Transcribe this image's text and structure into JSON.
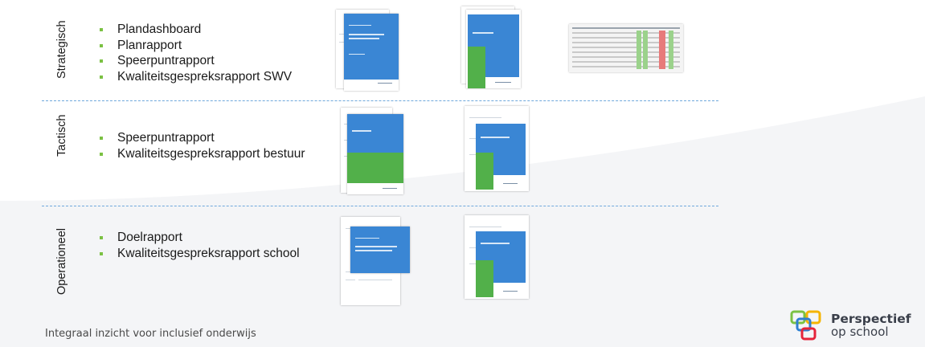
{
  "sections": [
    {
      "label": "Strategisch",
      "items": [
        "Plandashboard",
        "Planrapport",
        "Speerpuntrapport",
        "Kwaliteitsgespreksrapport SWV"
      ]
    },
    {
      "label": "Tactisch",
      "items": [
        "Speerpuntrapport",
        "Kwaliteitsgespreksrapport bestuur"
      ]
    },
    {
      "label": "Operationeel",
      "items": [
        "Doelrapport",
        "Kwaliteitsgespreksrapport school"
      ]
    }
  ],
  "footer": {
    "tagline": "Integraal inzicht voor inclusief onderwijs"
  },
  "logo": {
    "line1": "Perspectief",
    "line2": "op school"
  },
  "colors": {
    "accent_blue": "#3a86d4",
    "accent_green": "#52b04a",
    "bullet": "#7bc143",
    "divider": "#6fa8dc"
  }
}
